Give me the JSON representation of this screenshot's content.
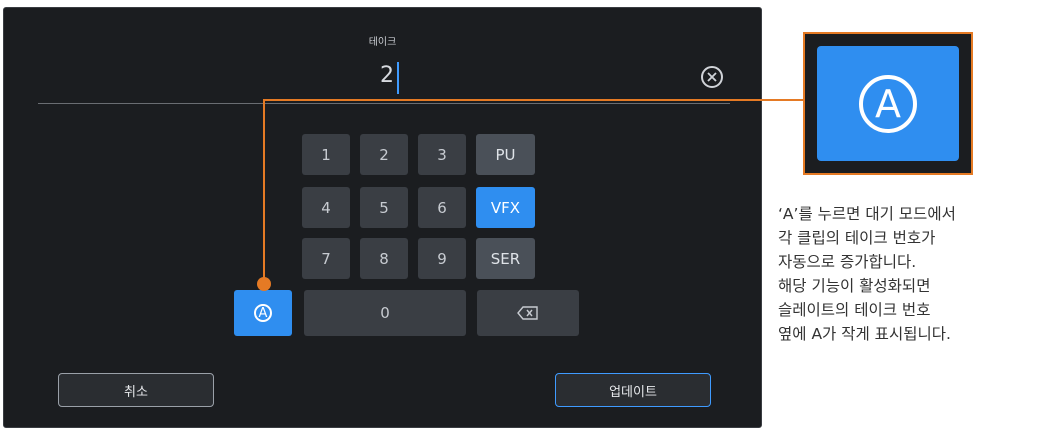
{
  "screen": {
    "field_label": "테이크",
    "field_value": "2"
  },
  "keypad": {
    "keys": [
      "1",
      "2",
      "3",
      "PU",
      "4",
      "5",
      "6",
      "VFX",
      "7",
      "8",
      "9",
      "SER",
      "0"
    ],
    "auto_key": "A",
    "active_key": "VFX"
  },
  "buttons": {
    "cancel": "취소",
    "update": "업데이트"
  },
  "callout": {
    "zoom_label": "A",
    "description": [
      "‘A’를 누르면 대기 모드에서",
      "각 클립의 테이크 번호가",
      "자동으로 증가합니다.",
      "해당 기능이 활성화되면",
      "슬레이트의 테이크 번호",
      "옆에 A가 작게 표시됩니다."
    ],
    "accent_color": "#e57a24",
    "key_active_color": "#2f8ef0"
  },
  "icons": {
    "clear": "clear-circle-x-icon",
    "backspace": "backspace-icon",
    "auto": "circled-a-icon"
  }
}
